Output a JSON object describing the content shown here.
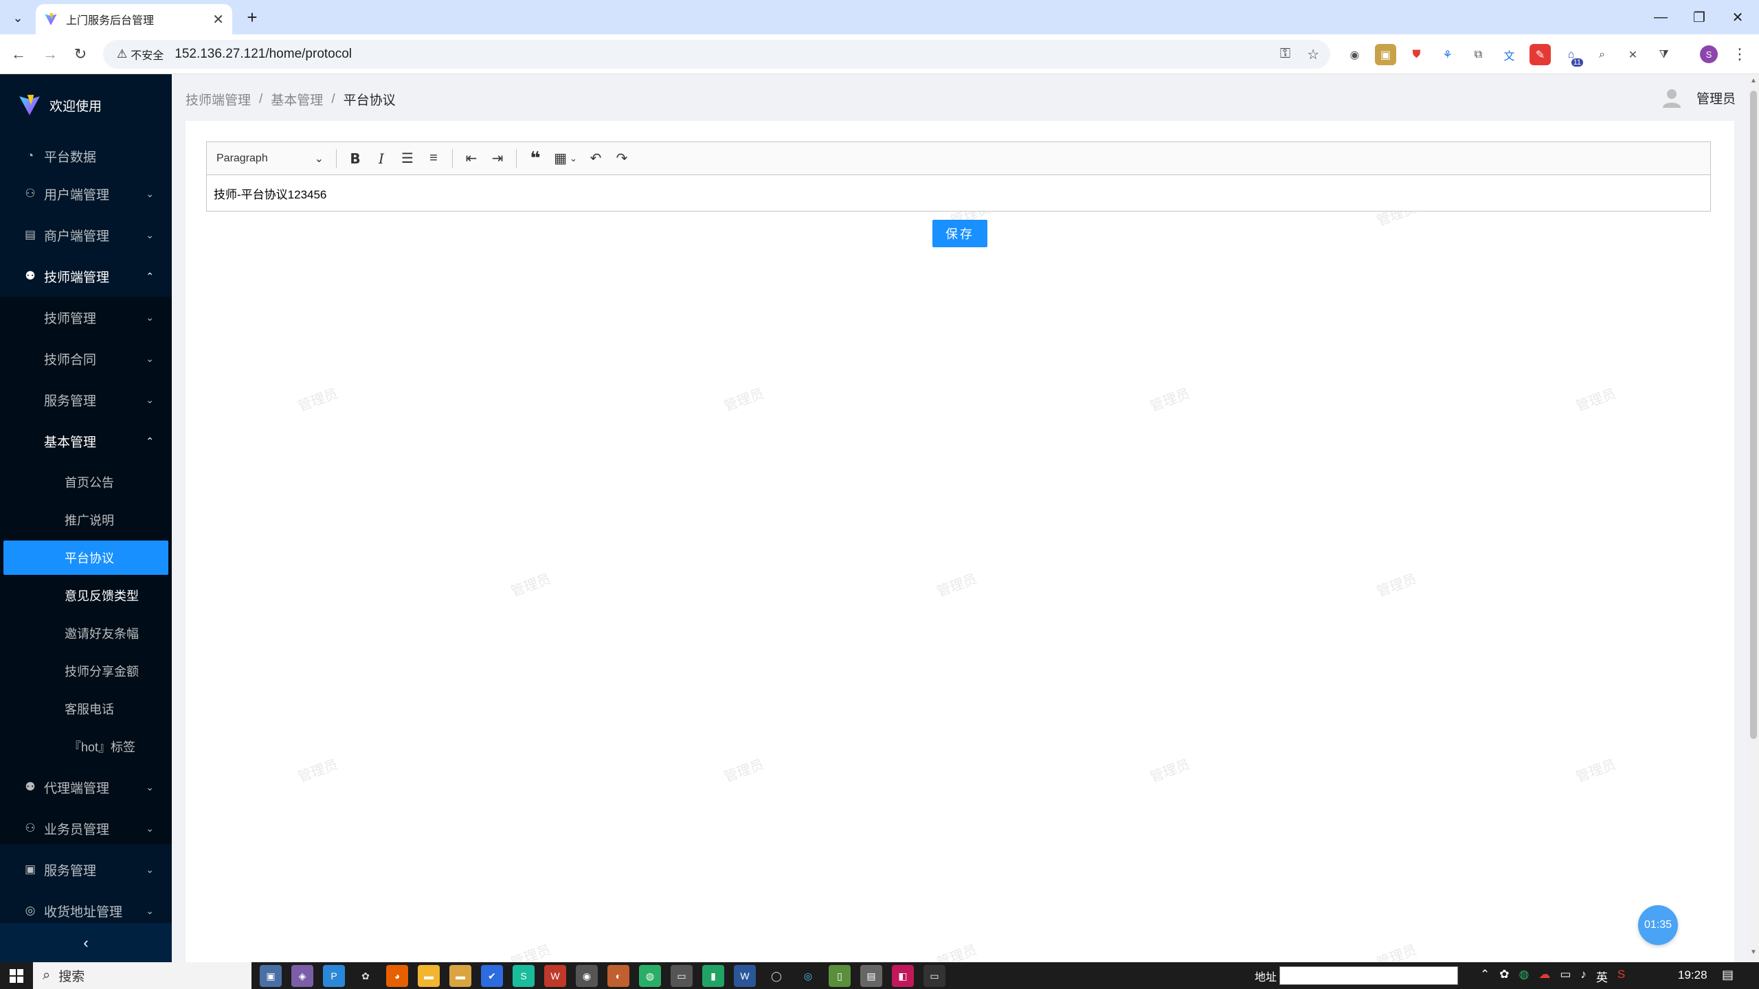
{
  "browser": {
    "tab_title": "上门服务后台管理",
    "security_label": "不安全",
    "url": "152.136.27.121/home/protocol",
    "profile_initial": "S",
    "extension_badge": "11"
  },
  "sidebar": {
    "brand": "欢迎使用",
    "items": {
      "platform_data": "平台数据",
      "user_mgmt": "用户端管理",
      "merchant_mgmt": "商户端管理",
      "technician_mgmt": "技师端管理",
      "agent_mgmt": "代理端管理",
      "salesman_mgmt": "业务员管理",
      "service_mgmt": "服务管理",
      "address_mgmt": "收货地址管理"
    },
    "technician_sub": {
      "tech_mgmt": "技师管理",
      "tech_contract": "技师合同",
      "service_mgmt": "服务管理",
      "basic_mgmt": "基本管理"
    },
    "basic_leaves": [
      "首页公告",
      "推广说明",
      "平台协议",
      "意见反馈类型",
      "邀请好友条幅",
      "技师分享金额",
      "客服电话",
      "『hot』标签"
    ]
  },
  "header": {
    "breadcrumb": [
      "技师端管理",
      "基本管理",
      "平台协议"
    ],
    "username": "管理员"
  },
  "editor": {
    "heading_select": "Paragraph",
    "content": "技师-平台协议123456"
  },
  "save_label": "保存",
  "watermark_text": "管理员",
  "timer": "01:35",
  "taskbar": {
    "search_placeholder": "搜索",
    "address_label": "地址",
    "ime": "英",
    "clock": "19:28"
  },
  "colors": {
    "sidebar_bg": "#001529",
    "accent": "#1890ff",
    "main_bg": "#f0f2f5"
  }
}
